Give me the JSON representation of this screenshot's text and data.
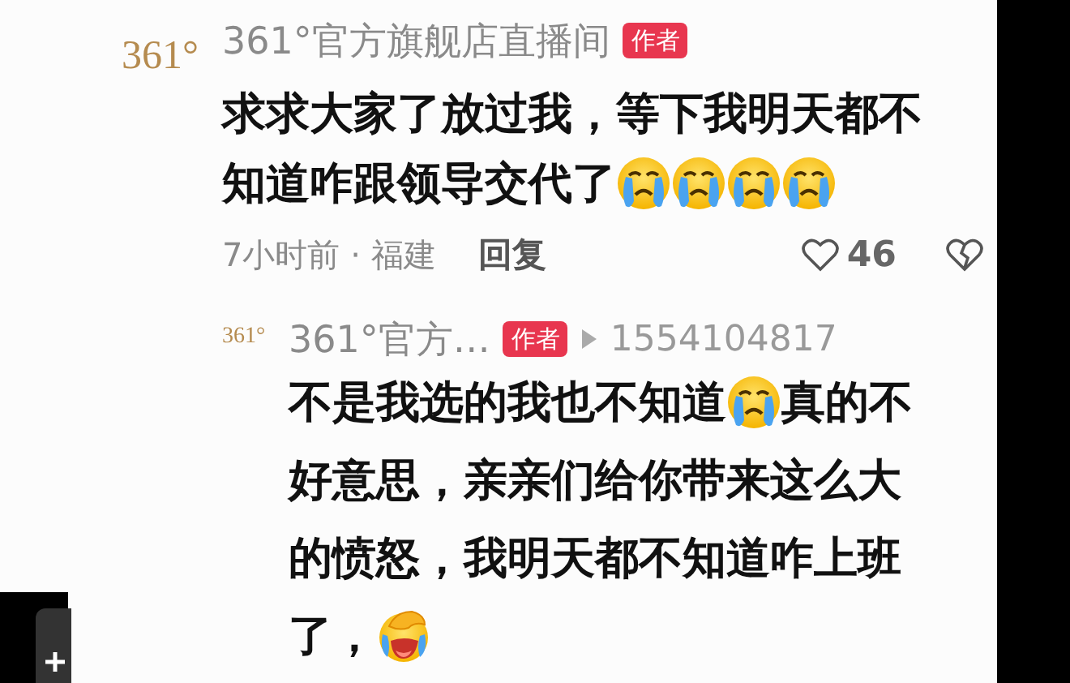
{
  "comment": {
    "avatar": "361°",
    "author": "361°官方旗舰店直播间",
    "badge": "作者",
    "lines": [
      [
        {
          "kind": "text",
          "text": "求求大家了放过我，等下我明天都不"
        }
      ],
      [
        {
          "kind": "text",
          "text": "知道咋跟领导交代了"
        },
        {
          "kind": "crying"
        },
        {
          "kind": "crying"
        },
        {
          "kind": "crying"
        },
        {
          "kind": "crying"
        }
      ]
    ],
    "time": "7小时前 · 福建",
    "reply_label": "回复",
    "likes": "46",
    "liked": false
  },
  "reply": {
    "avatar": "361°",
    "author": "361°官方…",
    "badge": "作者",
    "reply_to": "1554104817",
    "lines": [
      [
        {
          "kind": "text",
          "text": "不是我选的我也不知道"
        },
        {
          "kind": "crying"
        },
        {
          "kind": "text",
          "text": "真的不"
        }
      ],
      [
        {
          "kind": "text",
          "text": "好意思，亲亲们给你带来这么大"
        }
      ],
      [
        {
          "kind": "text",
          "text": "的愤怒，我明天都不知道咋上班"
        }
      ],
      [
        {
          "kind": "text",
          "text": "了，"
        },
        {
          "kind": "laughing"
        }
      ]
    ]
  }
}
